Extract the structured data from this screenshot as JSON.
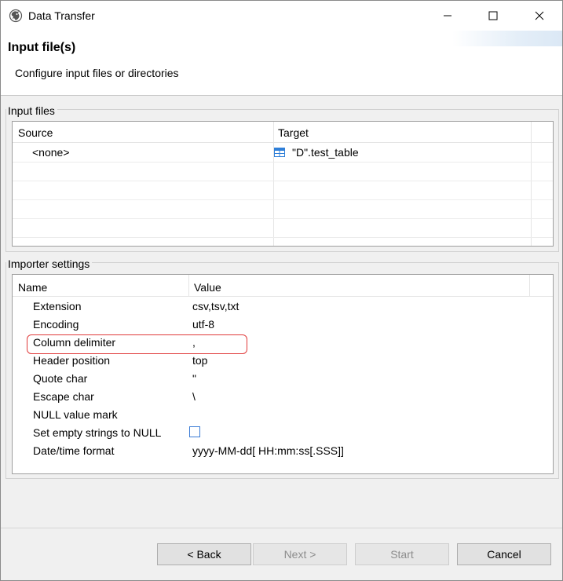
{
  "window": {
    "title": "Data Transfer"
  },
  "header": {
    "title": "Input file(s)",
    "description": "Configure input files or directories"
  },
  "input_files": {
    "group_label": "Input files",
    "columns": [
      "Source",
      "Target"
    ],
    "rows": [
      {
        "source": "<none>",
        "target": "\"D\".test_table",
        "target_icon": "table-icon"
      }
    ]
  },
  "importer_settings": {
    "group_label": "Importer settings",
    "columns": [
      "Name",
      "Value"
    ],
    "rows": [
      {
        "name": "Extension",
        "value": "csv,tsv,txt"
      },
      {
        "name": "Encoding",
        "value": "utf-8"
      },
      {
        "name": "Column delimiter",
        "value": ","
      },
      {
        "name": "Header position",
        "value": "top"
      },
      {
        "name": "Quote char",
        "value": "\""
      },
      {
        "name": "Escape char",
        "value": "\\"
      },
      {
        "name": "NULL value mark",
        "value": ""
      },
      {
        "name": "Set empty strings to NULL",
        "value": "",
        "checkbox_checked": false
      },
      {
        "name": "Date/time format",
        "value": "yyyy-MM-dd[ HH:mm:ss[.SSS]]"
      }
    ],
    "highlighted_row": "Column delimiter",
    "highlight_color": "#e03a3a"
  },
  "buttons": {
    "back": "< Back",
    "next": "Next >",
    "start": "Start",
    "cancel": "Cancel"
  },
  "colors": {
    "checkbox_border": "#3a7bd5",
    "table_icon": "#2f7fd8"
  }
}
